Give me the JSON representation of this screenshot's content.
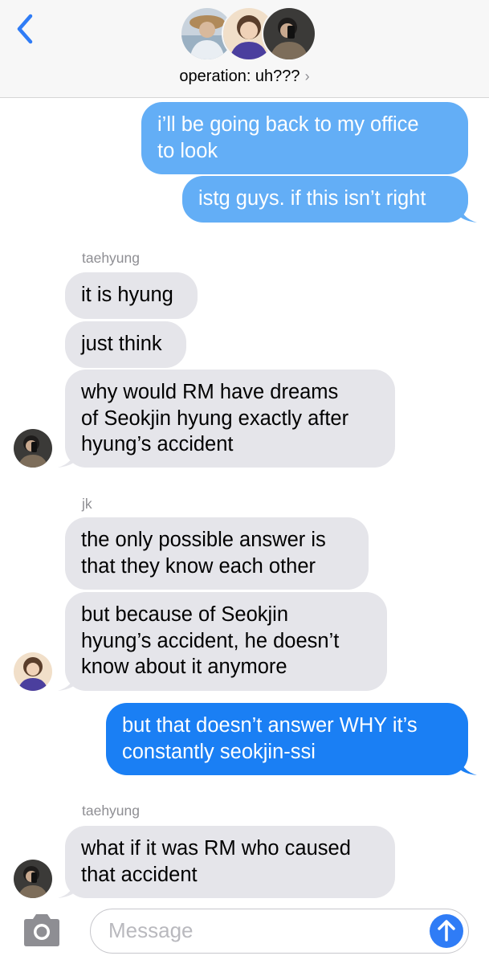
{
  "header": {
    "back_icon": "chevron-left-icon",
    "group_name": "operation: uh???",
    "group_chevron": "›",
    "accent_color": "#2f7cf6"
  },
  "messages": {
    "out1": {
      "lines": [
        "i’ll be going back to my office",
        "to look"
      ]
    },
    "out2": {
      "lines": [
        "istg guys. if this isn’t right"
      ]
    },
    "sender1": "taehyung",
    "in1": {
      "lines": [
        "it is hyung"
      ]
    },
    "in2": {
      "lines": [
        "just think"
      ]
    },
    "in3": {
      "lines": [
        "why would RM have dreams",
        "of Seokjin hyung exactly after",
        "hyung’s accident"
      ]
    },
    "sender2": "jk",
    "in4": {
      "lines": [
        "the only possible answer is",
        "that they know each other"
      ]
    },
    "in5": {
      "lines": [
        "but because of Seokjin",
        "hyung’s accident, he doesn’t",
        "know about it anymore"
      ]
    },
    "out3": {
      "lines": [
        "but that doesn’t answer WHY it’s",
        "constantly seokjin-ssi"
      ]
    },
    "sender3": "taehyung",
    "in6": {
      "lines": [
        "what if it was RM who caused",
        "that accident"
      ]
    }
  },
  "composer": {
    "placeholder": "Message",
    "camera_icon": "camera-icon",
    "send_icon": "arrow-up-icon"
  },
  "colors": {
    "incoming_bubble": "#e5e5ea",
    "outgoing_bubble_light": "#63aef6",
    "outgoing_bubble_dark": "#1a7ff4",
    "send_button": "#2f7cf6"
  }
}
